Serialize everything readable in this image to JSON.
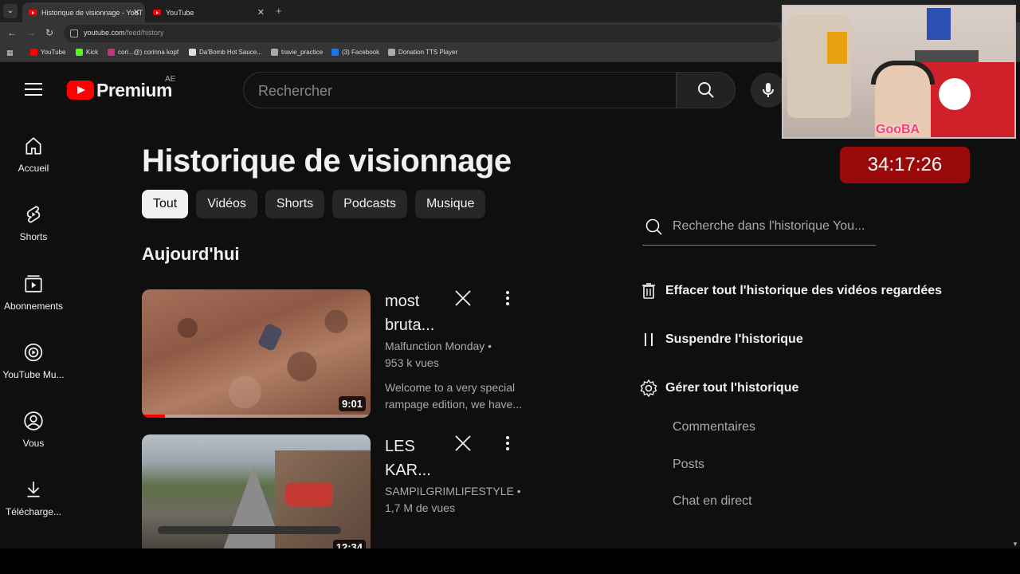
{
  "browser": {
    "tabs": [
      {
        "label": "Historique de visionnage - YouT",
        "active": true
      },
      {
        "label": "YouTube",
        "active": false
      }
    ],
    "url_host": "youtube.com",
    "url_path": "/feed/history",
    "bookmarks": [
      {
        "label": "YouTube",
        "color": "#ff0000"
      },
      {
        "label": "Kick",
        "color": "#53fc18"
      },
      {
        "label": "cori...@) corinna kopf",
        "color": "#c13584"
      },
      {
        "label": "Da'Bomb Hot Sauce...",
        "color": "#dddddd"
      },
      {
        "label": "travie_practice",
        "color": "#aaaaaa"
      },
      {
        "label": "(3) Facebook",
        "color": "#1877f2"
      },
      {
        "label": "Donation TTS Player",
        "color": "#aaaaaa"
      }
    ]
  },
  "header": {
    "logo_text": "Premium",
    "region": "AE",
    "search_placeholder": "Rechercher"
  },
  "sidebar": {
    "items": [
      {
        "label": "Accueil",
        "icon": "home-icon"
      },
      {
        "label": "Shorts",
        "icon": "shorts-icon"
      },
      {
        "label": "Abonnements",
        "icon": "subscriptions-icon"
      },
      {
        "label": "YouTube Mu...",
        "icon": "youtube-music-icon"
      },
      {
        "label": "Vous",
        "icon": "user-icon"
      },
      {
        "label": "Télécharge...",
        "icon": "download-icon"
      }
    ]
  },
  "main": {
    "title": "Historique de visionnage",
    "chips": [
      "Tout",
      "Vidéos",
      "Shorts",
      "Podcasts",
      "Musique"
    ],
    "section": "Aujourd'hui",
    "videos": [
      {
        "title_line1": "most",
        "title_line2": "bruta...",
        "channel": "Malfunction Monday",
        "views": "953 k vues",
        "desc_line1": "Welcome to a very special",
        "desc_line2": "rampage edition, we have...",
        "duration": "9:01",
        "watched_fraction": 0.1
      },
      {
        "title_line1": "LES",
        "title_line2": "KAR...",
        "channel": "SAMPILGRIMLIFESTYLE",
        "views": "1,7 M de vues",
        "duration": "12:34"
      }
    ]
  },
  "panel": {
    "search_placeholder": "Recherche dans l'historique You...",
    "clear_all": "Effacer tout l'historique des vidéos regardées",
    "pause": "Suspendre l'historique",
    "manage": "Gérer tout l'historique",
    "links": [
      "Commentaires",
      "Posts",
      "Chat en direct"
    ]
  },
  "overlay": {
    "timer": "34:17:26",
    "nickname": "GooBA"
  }
}
